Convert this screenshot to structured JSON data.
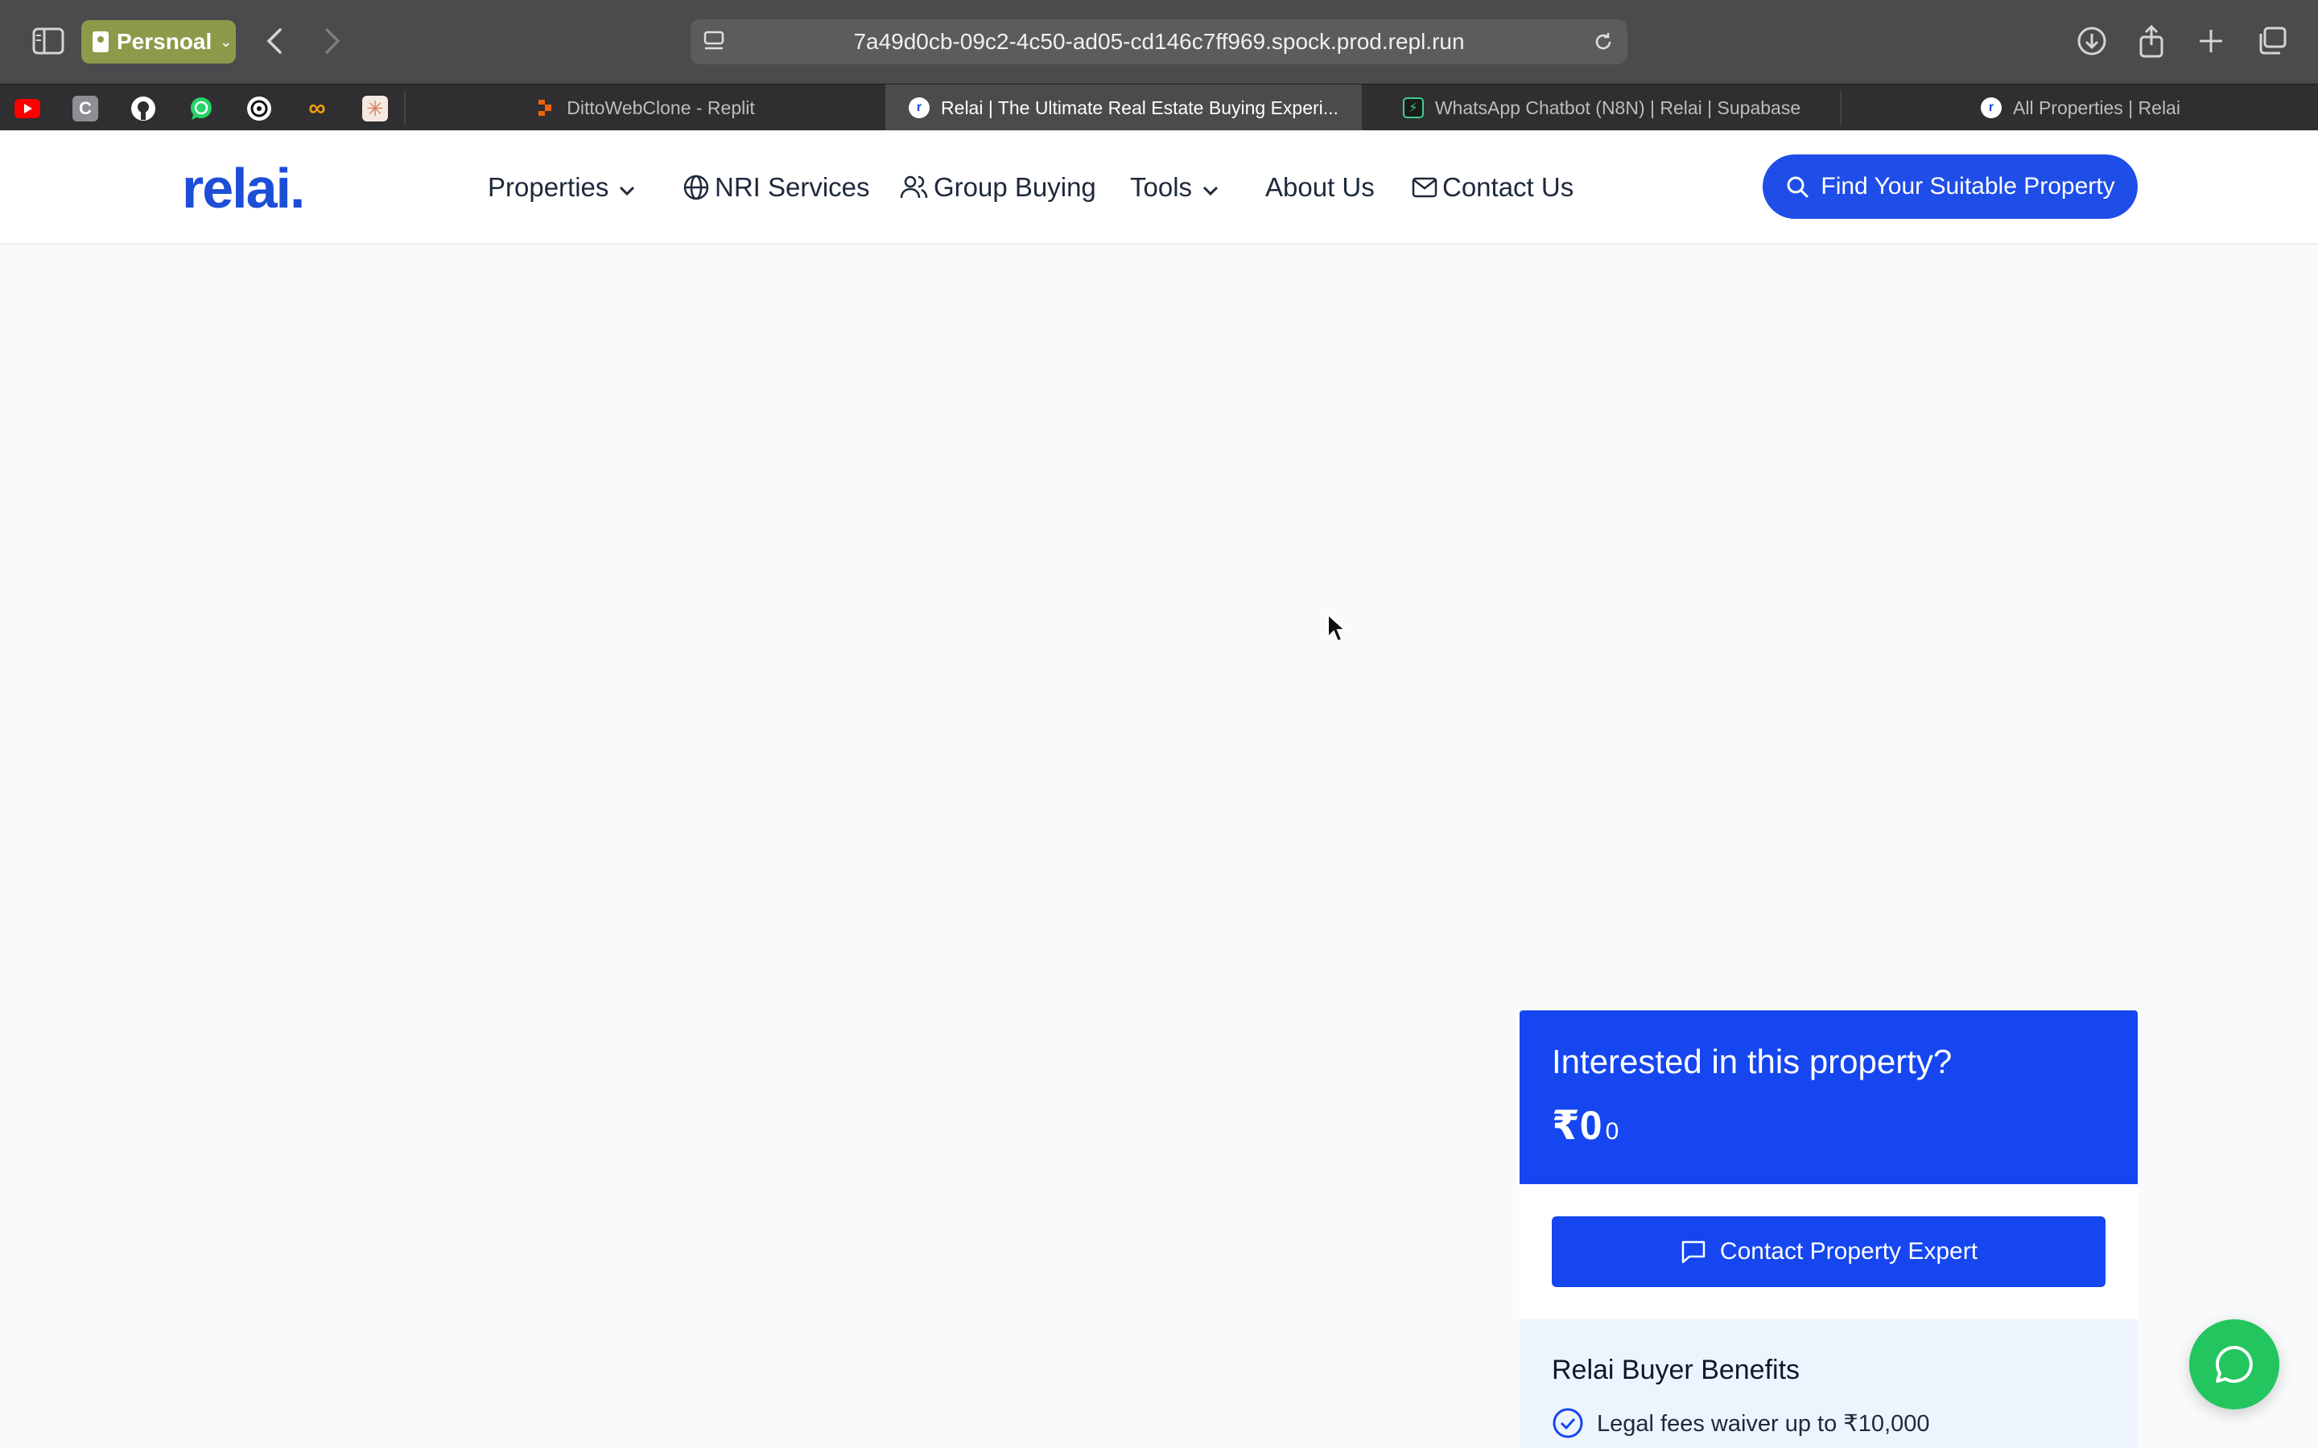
{
  "browser": {
    "profile_label": "Persnoal",
    "url": "7a49d0cb-09c2-4c50-ad05-cd146c7ff969.spock.prod.repl.run",
    "bookmarks": [
      "youtube-icon",
      "c-icon",
      "github-icon",
      "whatsapp-icon",
      "chatgpt-icon",
      "infinity-icon",
      "claude-icon"
    ],
    "tabs": [
      {
        "label": "DittoWebClone - Replit",
        "active": false
      },
      {
        "label": "Relai | The Ultimate Real Estate Buying Experi...",
        "active": true
      },
      {
        "label": "WhatsApp Chatbot (N8N) | Relai | Supabase",
        "active": false
      },
      {
        "label": "All Properties | Relai",
        "active": false
      }
    ]
  },
  "header": {
    "logo": "relai.",
    "nav": {
      "properties": "Properties",
      "nri": "NRI Services",
      "group": "Group Buying",
      "tools": "Tools",
      "about": "About Us",
      "contact": "Contact Us"
    },
    "cta_label": "Find Your Suitable Property"
  },
  "card": {
    "title": "Interested in this property?",
    "price_main": "₹0",
    "price_sub": "0",
    "button_label": "Contact Property Expert"
  },
  "benefits": {
    "title": "Relai Buyer Benefits",
    "items": [
      "Legal fees waiver up to ₹10,000"
    ]
  },
  "colors": {
    "brand_blue": "#1546f0",
    "chat_green": "#22c55e"
  }
}
